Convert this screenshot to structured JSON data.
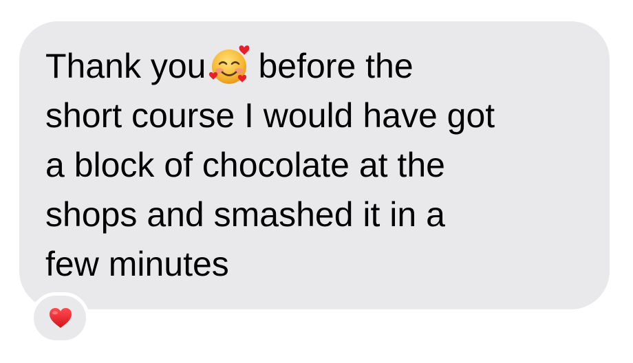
{
  "message": {
    "lines": [
      {
        "before_emoji": "Thank you",
        "after_emoji": "before the"
      },
      {
        "text": "short course I would have got"
      },
      {
        "text": "a block of chocolate at the"
      },
      {
        "text": "shops and smashed it in a"
      },
      {
        "text": "few minutes"
      }
    ],
    "emoji": "smiling-face-with-hearts-icon"
  },
  "reaction": {
    "icon": "red-heart-icon",
    "color": "#e8202a"
  },
  "colors": {
    "bubble": "#e9e9eb",
    "text": "#000000",
    "background": "#ffffff"
  }
}
